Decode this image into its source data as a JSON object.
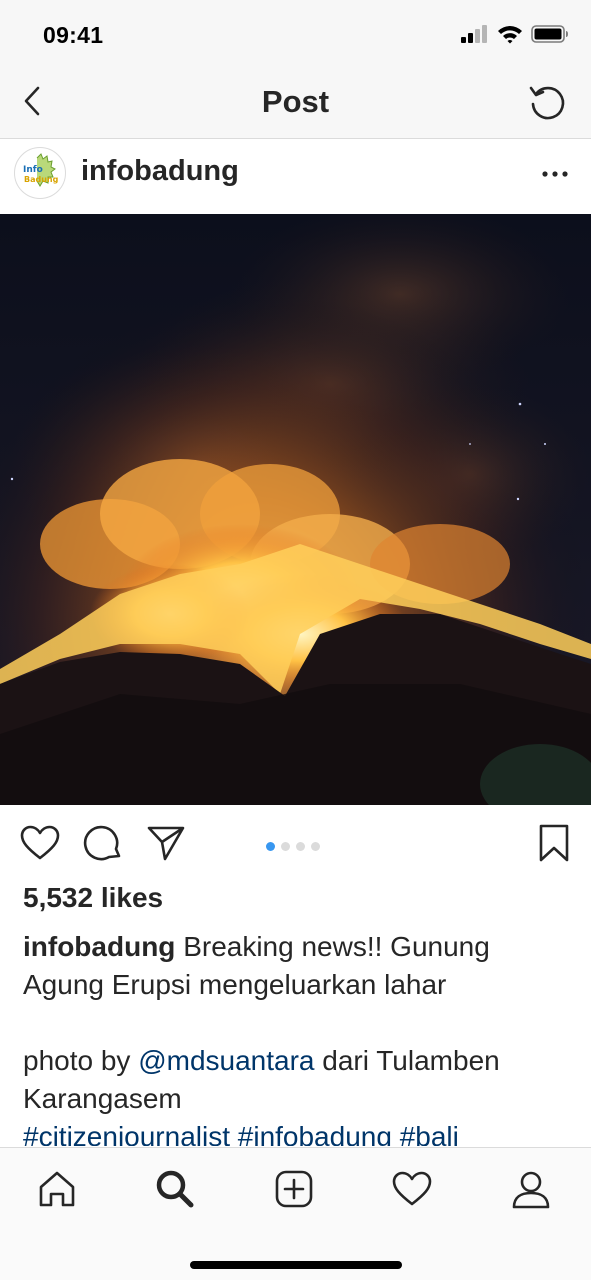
{
  "status_bar": {
    "time": "09:41",
    "icons": [
      "cellular-signal-icon",
      "wifi-icon",
      "battery-icon"
    ]
  },
  "nav": {
    "title": "Post",
    "back_icon": "chevron-left-icon",
    "right_icon": "refresh-icon"
  },
  "post": {
    "username": "infobadung",
    "avatar_logo_text": [
      "Info",
      "Badung"
    ],
    "more_icon": "ellipsis-icon",
    "image_alt": "volcano-eruption-photo",
    "carousel": {
      "count": 4,
      "active_index": 0
    },
    "likes": "5,532 likes",
    "caption": {
      "user": "infobadung",
      "line1": "Breaking news!! Gunung Agung Erupsi mengeluarkan lahar",
      "photo_by": "photo by",
      "mention": "@mdsuantara",
      "location_text": "dari Tulamben Karangasem",
      "hashtags": "#citizenjournalist #infobadung #bali"
    }
  },
  "actions": {
    "icons": [
      "heart-icon",
      "comment-icon",
      "share-icon",
      "bookmark-icon"
    ]
  },
  "tab_bar": {
    "tabs": [
      "home-icon",
      "search-icon",
      "add-post-icon",
      "activity-heart-icon",
      "profile-icon"
    ],
    "active": "search-icon"
  },
  "colors": {
    "accent_blue": "#3897f0",
    "link_blue": "#003569",
    "text": "#262626",
    "divider": "#dbdbdb"
  }
}
